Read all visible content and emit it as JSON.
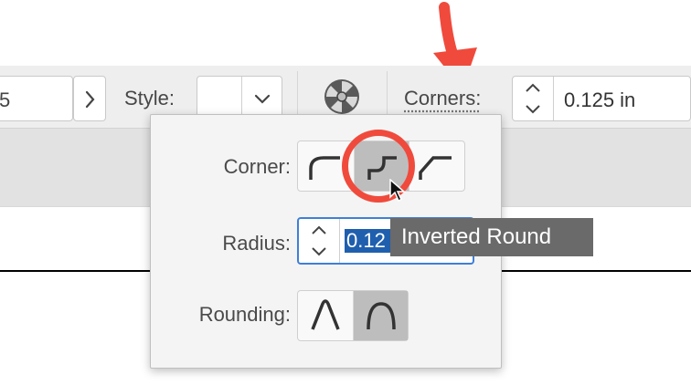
{
  "toolbar": {
    "left_field_value": "5",
    "style_label": "Style:",
    "corners_label": "Corners:",
    "corners_value": "0.125 in"
  },
  "popover": {
    "corner_label": "Corner:",
    "corner_options": [
      "Round",
      "Inverted Round",
      "Chamfer"
    ],
    "corner_selected": "Inverted Round",
    "radius_label": "Radius:",
    "radius_value": "0.125 in",
    "radius_visible_text": "0.12",
    "rounding_label": "Rounding:",
    "rounding_options": [
      "Absolute",
      "Relative"
    ],
    "rounding_selected": "Relative"
  },
  "tooltip": {
    "text": "Inverted Round"
  },
  "annotation": {
    "color": "#f04a3c"
  }
}
